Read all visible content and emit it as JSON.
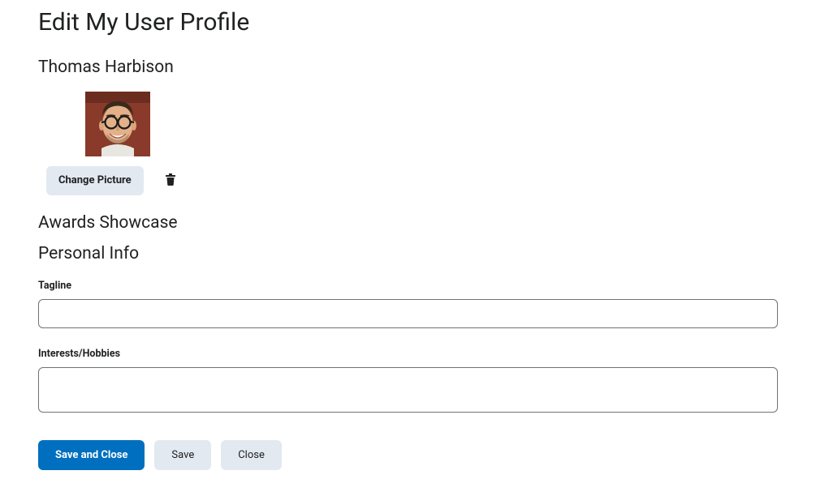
{
  "page": {
    "title": "Edit My User Profile"
  },
  "user": {
    "name": "Thomas Harbison"
  },
  "picture": {
    "change_label": "Change Picture"
  },
  "sections": {
    "awards": "Awards Showcase",
    "personal": "Personal Info"
  },
  "fields": {
    "tagline": {
      "label": "Tagline",
      "value": ""
    },
    "interests": {
      "label": "Interests/Hobbies",
      "value": ""
    }
  },
  "actions": {
    "save_and_close": "Save and Close",
    "save": "Save",
    "close": "Close"
  }
}
